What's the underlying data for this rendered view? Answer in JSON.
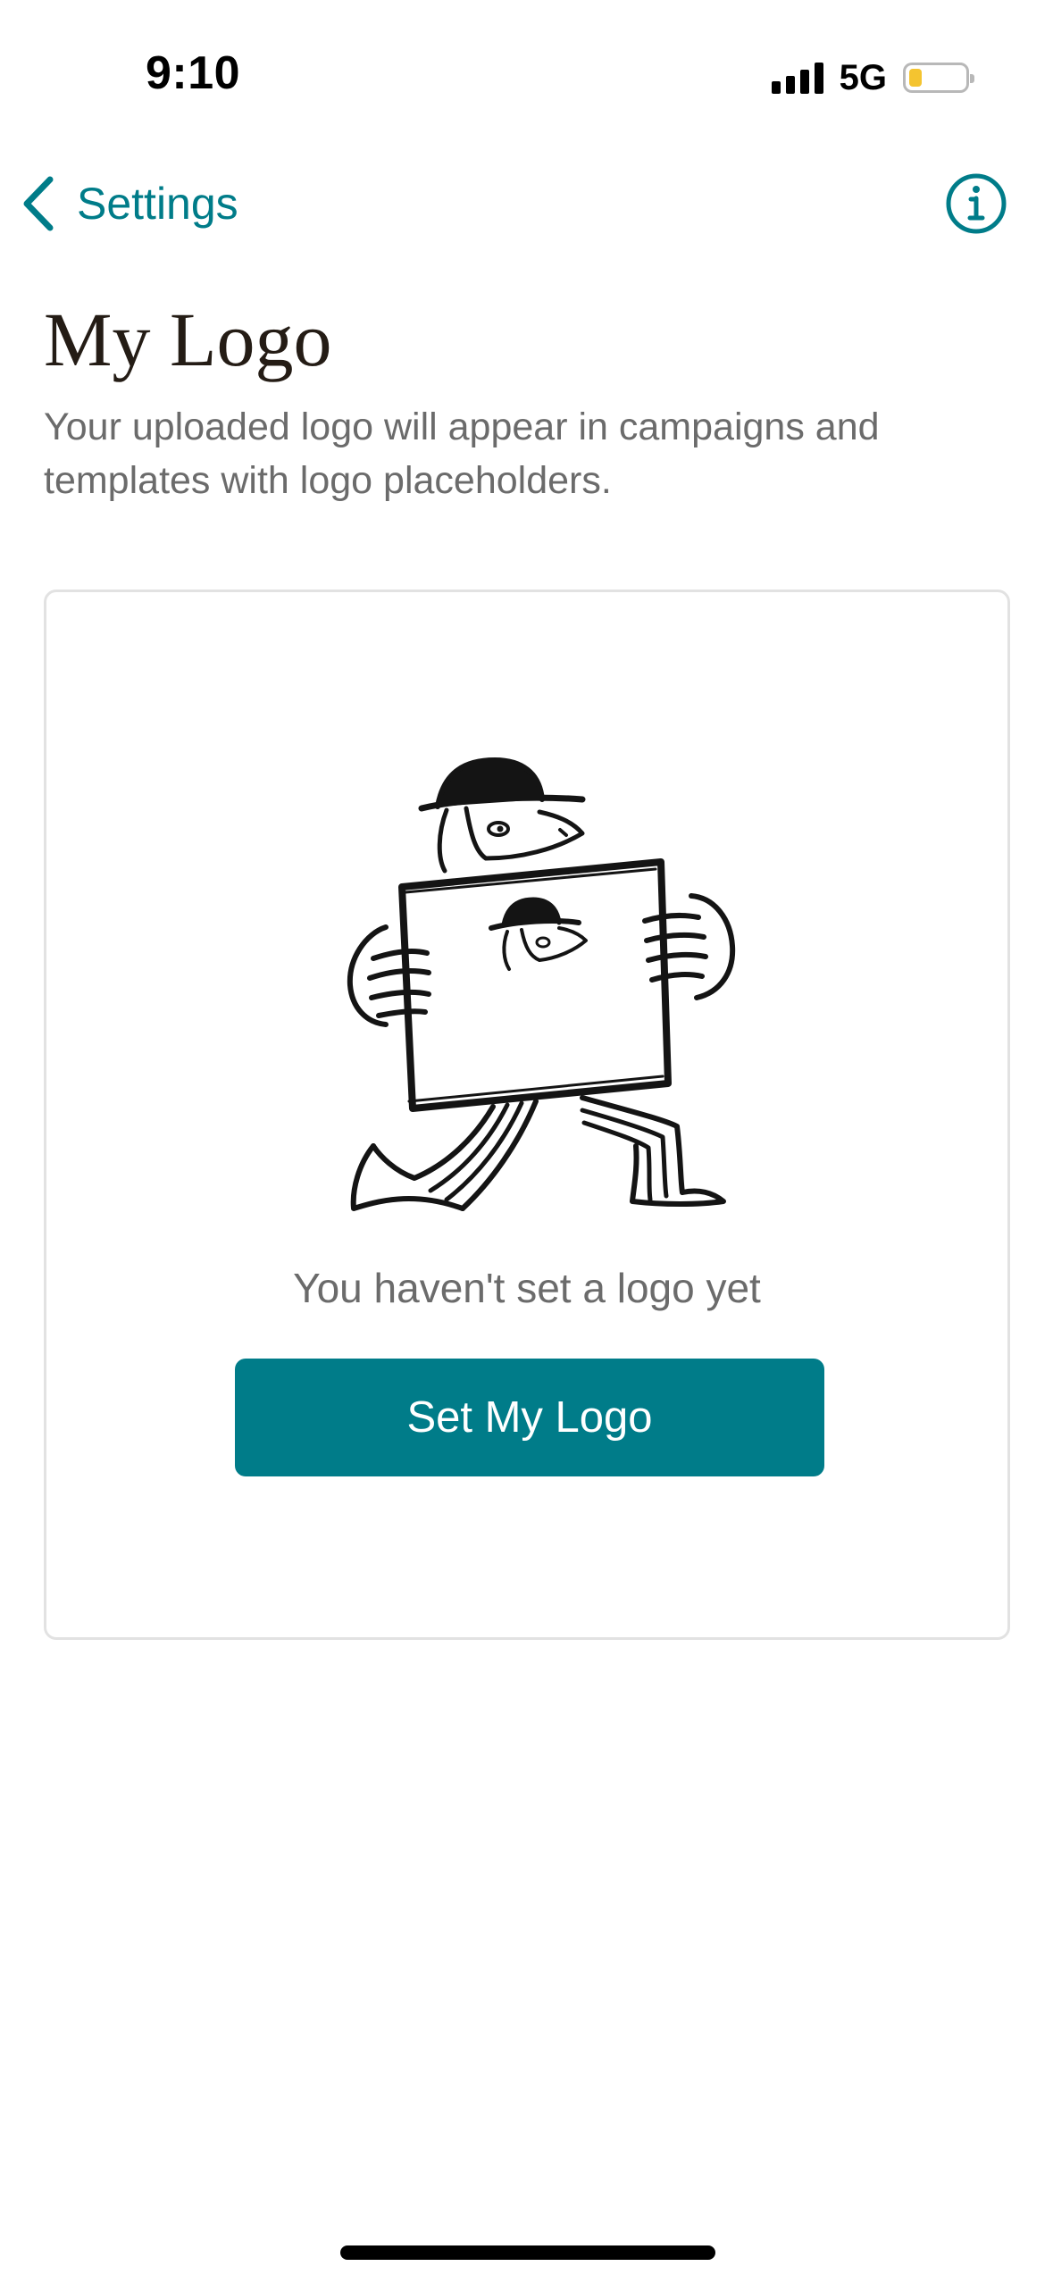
{
  "status_bar": {
    "time": "9:10",
    "network": "5G",
    "icons": [
      "cellular-signal-icon",
      "battery-low-icon"
    ],
    "battery_color": "#f4c430"
  },
  "nav": {
    "back_label": "Settings",
    "back_icon": "chevron-left-icon",
    "info_icon": "info-icon",
    "accent_color": "#007c89"
  },
  "header": {
    "title": "My Logo",
    "description": "Your uploaded logo will appear in campaigns and templates with logo placeholders."
  },
  "card": {
    "illustration": "dog-holding-logo-sign-illustration",
    "empty_text": "You haven't set a logo yet",
    "button_label": "Set My Logo",
    "button_color": "#007c89"
  }
}
